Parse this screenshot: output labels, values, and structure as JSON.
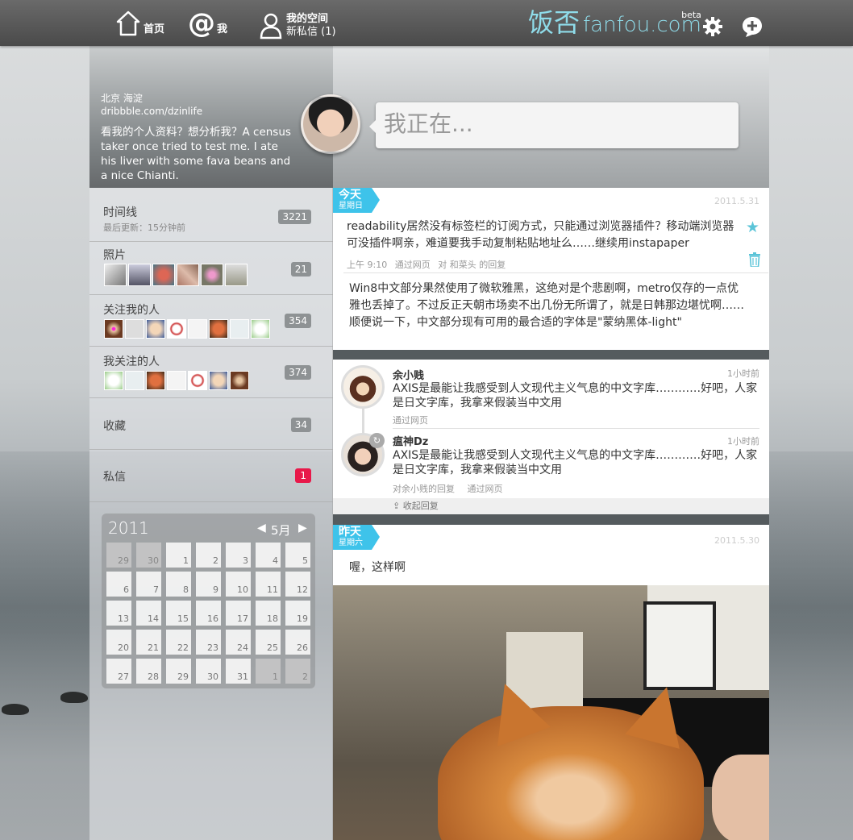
{
  "nav": {
    "home_label": "首页",
    "me_label": "我",
    "space_label": "我的空间",
    "messages_label": "新私信 (1)"
  },
  "logo": {
    "cn": "饭否",
    "en": "fanfou.com",
    "beta": "beta"
  },
  "profile": {
    "location": "北京 海淀",
    "url": "dribbble.com/dzinlife",
    "bio": "看我的个人资料？想分析我？A census taker once tried to test me. I ate his liver with some fava beans and a nice Chianti."
  },
  "status_input": {
    "placeholder": "我正在..."
  },
  "menu": {
    "timeline": {
      "label": "时间线",
      "sub": "最后更新：15分钟前",
      "count": "3221"
    },
    "photos": {
      "label": "照片",
      "count": "21"
    },
    "followers": {
      "label": "关注我的人",
      "count": "354"
    },
    "following": {
      "label": "我关注的人",
      "count": "374"
    },
    "favorites": {
      "label": "收藏",
      "count": "34"
    },
    "messages": {
      "label": "私信",
      "count": "1"
    }
  },
  "calendar": {
    "year": "2011",
    "month": "5月",
    "days": [
      "29",
      "30",
      "1",
      "2",
      "3",
      "4",
      "5",
      "6",
      "7",
      "8",
      "9",
      "10",
      "11",
      "12",
      "13",
      "14",
      "15",
      "16",
      "17",
      "18",
      "19",
      "20",
      "21",
      "22",
      "23",
      "24",
      "25",
      "26",
      "27",
      "28",
      "29",
      "30",
      "31",
      "1",
      "2"
    ]
  },
  "today": {
    "day_label": "今天",
    "weekday": "星期日",
    "date": "2011.5.31",
    "post1": {
      "text": "readability居然没有标签栏的订阅方式，只能通过浏览器插件？移动端浏览器可没插件啊亲，难道要我手动复制粘贴地址么……继续用instapaper",
      "time": "上午 9:10",
      "via": "通过网页",
      "reply_to": "对 和菜头 的回复"
    },
    "post2": {
      "text": "Win8中文部分果然使用了微软雅黑，这绝对是个悲剧啊，metro仅存的一点优雅也丢掉了。不过反正天朝市场卖不出几份无所谓了，就是日韩那边堪忧啊……顺便说一下，中文部分现有可用的最合适的字体是\"蒙纳黑体-light\""
    }
  },
  "thread": {
    "reply1": {
      "name": "余小贱",
      "time": "1小时前",
      "text": "AXIS是最能让我感受到人文现代主义气息的中文字库…………好吧，人家是日文字库，我拿来假装当中文用",
      "via": "通过网页"
    },
    "reply2": {
      "name": "瘟神Dz",
      "time": "1小时前",
      "text": "AXIS是最能让我感受到人文现代主义气息的中文字库…………好吧，人家是日文字库，我拿来假装当中文用",
      "reply_to": "对余小贱的回复",
      "via": "通过网页"
    },
    "collapse_label": "收起回复"
  },
  "yesterday": {
    "day_label": "昨天",
    "weekday": "星期六",
    "date": "2011.5.30",
    "post": "喔，这样啊"
  },
  "colors": {
    "accent": "#3ec3ea",
    "topbar": "#555555",
    "badge_red": "#e8194a",
    "count_gray": "#8e9294"
  }
}
